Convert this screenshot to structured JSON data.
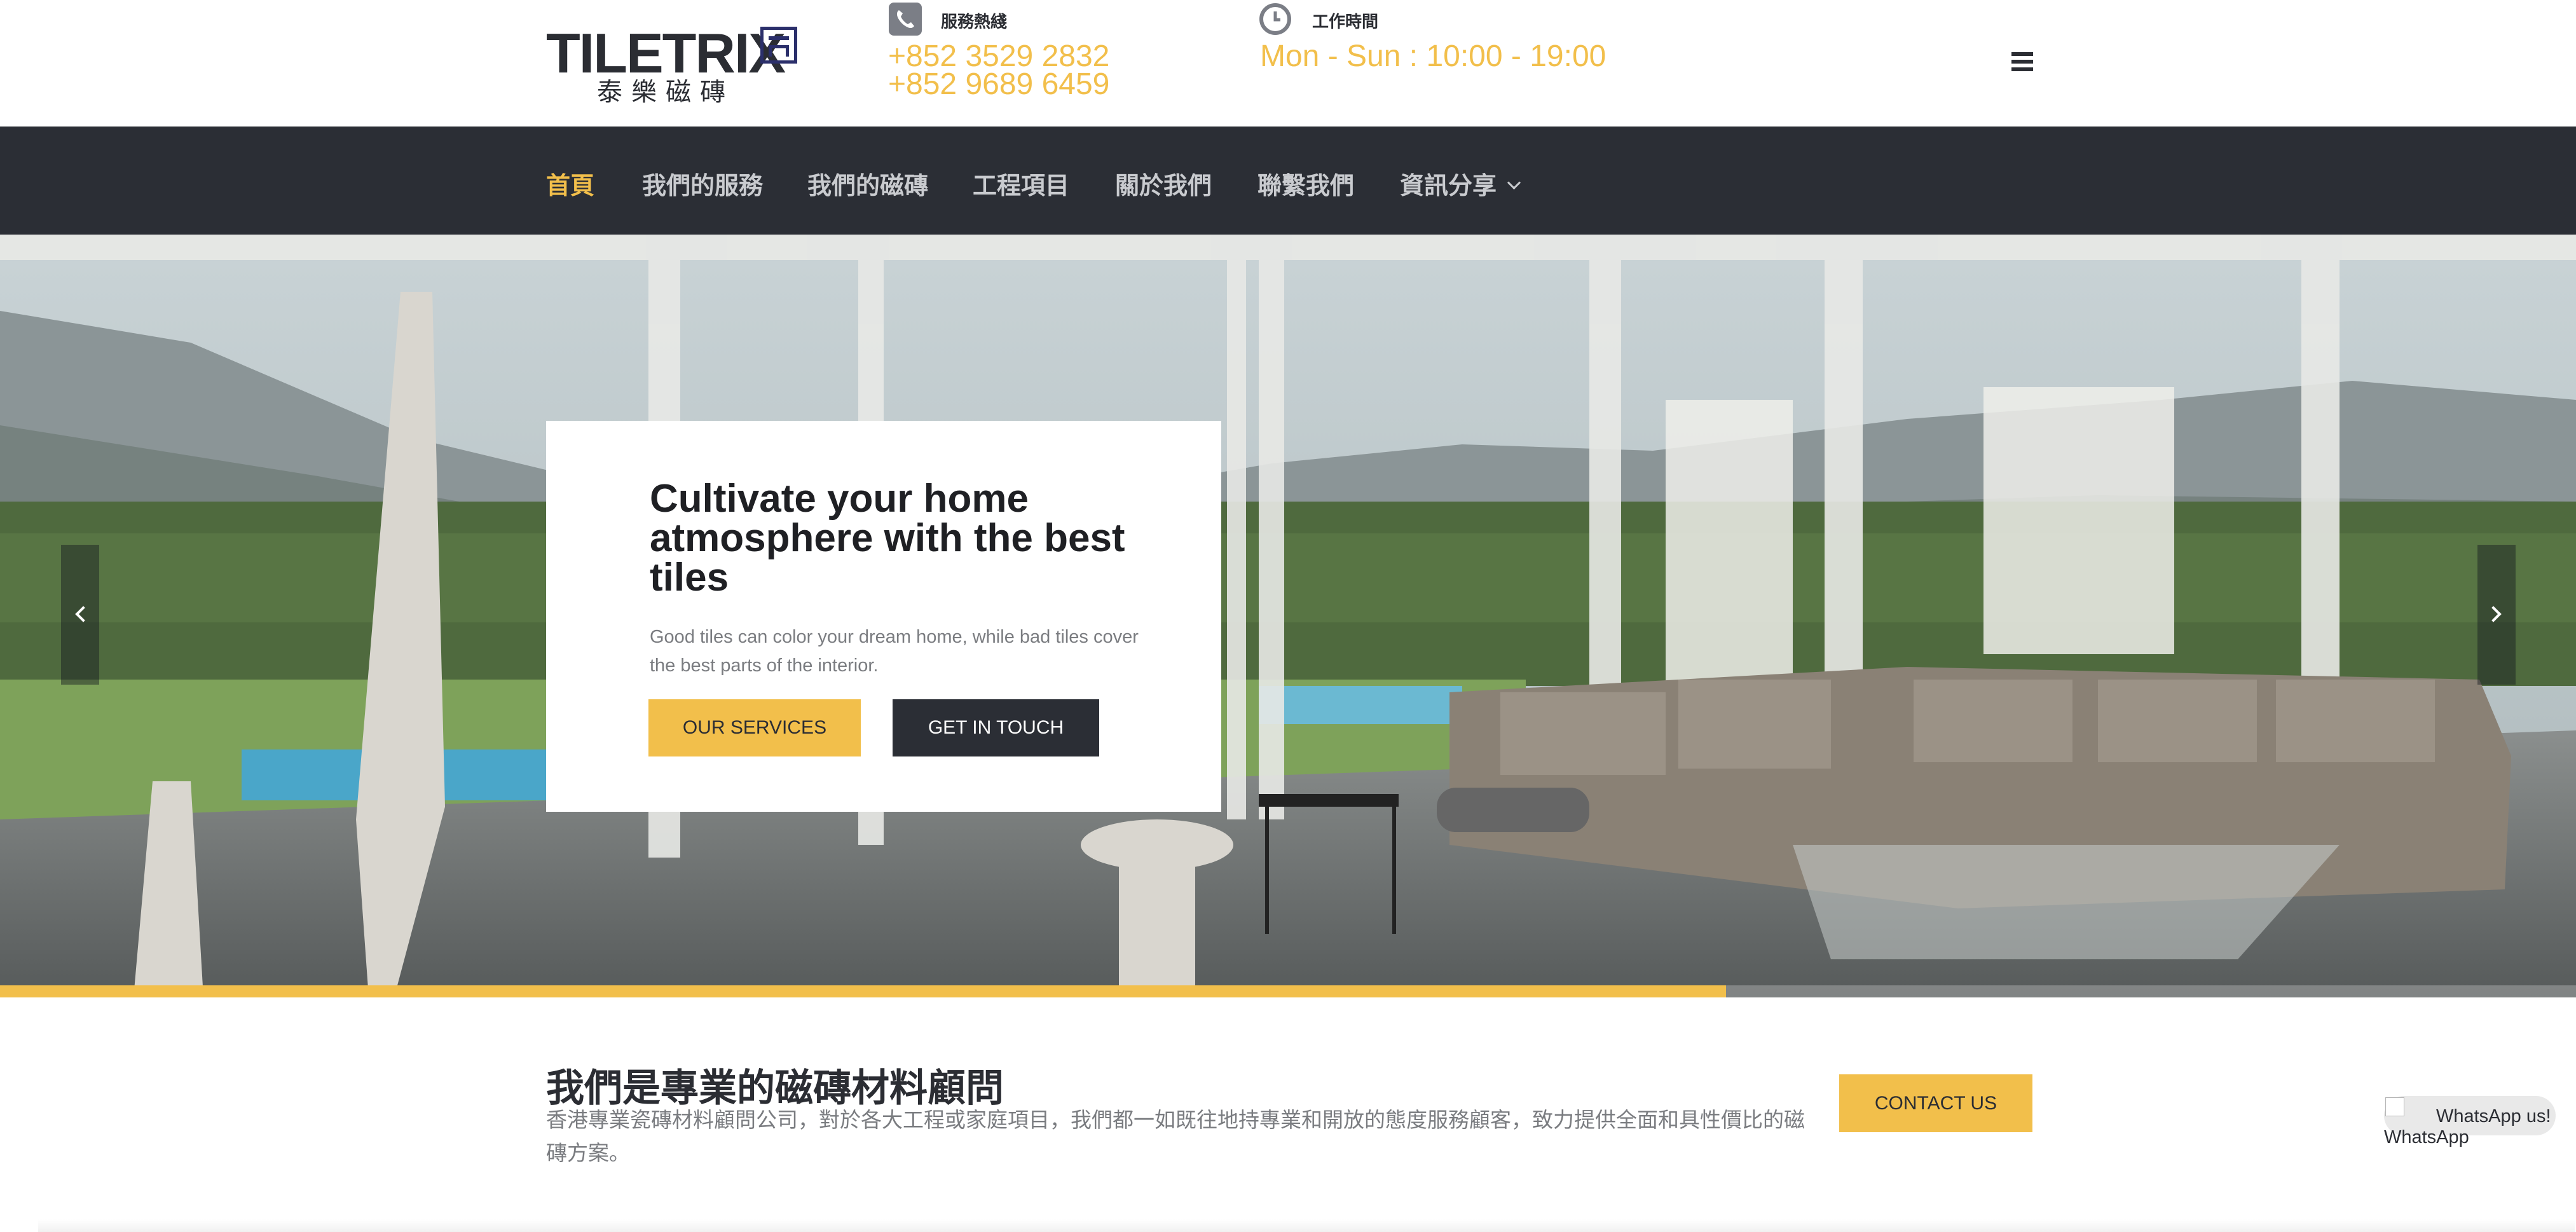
{
  "brand": {
    "logo_text": "TILETRIX",
    "logo_sub": "泰樂磁磚"
  },
  "header": {
    "phone_label": "服務熱綫",
    "phones": [
      "+852 3529 2832",
      "+852 9689 6459"
    ],
    "hours_label": "工作時間",
    "hours": "Mon - Sun : 10:00 - 19:00"
  },
  "nav": {
    "items": [
      {
        "label": "首頁",
        "active": true
      },
      {
        "label": "我們的服務"
      },
      {
        "label": "我們的磁磚"
      },
      {
        "label": "工程項目"
      },
      {
        "label": "關於我們"
      },
      {
        "label": "聯繫我們"
      },
      {
        "label": "資訊分享",
        "has_dropdown": true
      }
    ]
  },
  "hero": {
    "title": "Cultivate your home atmosphere with the best tiles",
    "description": "Good tiles can color your dream home, while bad tiles cover the best parts of the interior.",
    "primary_button": "OUR SERVICES",
    "secondary_button": "GET IN TOUCH",
    "slide_progress": 0.67
  },
  "intro": {
    "title": "我們是專業的磁磚材料顧問",
    "description": "香港專業瓷磚材料顧問公司，對於各大工程或家庭項目，我們都一如既往地持專業和開放的態度服務顧客，致力提供全面和具性價比的磁磚方案。",
    "contact_button": "CONTACT US"
  },
  "whatsapp": {
    "bubble_text": "WhatsApp us!",
    "alt_text": "WhatsApp"
  },
  "colors": {
    "accent": "#f2bf4b",
    "nav_bg": "#2b2e35",
    "dark_text": "#2b2d33"
  }
}
